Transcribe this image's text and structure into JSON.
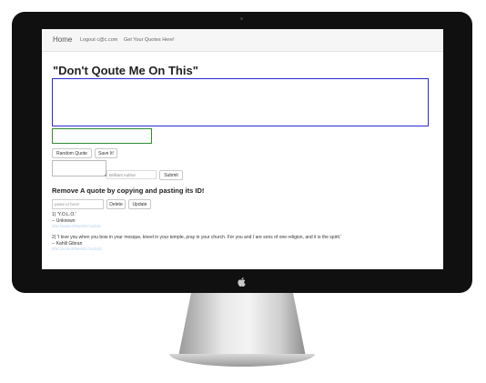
{
  "navbar": {
    "home_label": "Home",
    "logout_label": "Logout c@c.com",
    "get_quotes_label": "Get Your Quotes Here!"
  },
  "main": {
    "title": "\"Don't Qoute Me On This\"",
    "random_quote_button": "Random Quote",
    "save_button": "Save It!",
    "author_placeholder": "Brilliant Author",
    "submit_button": "Submit",
    "remove_heading": "Remove A quote by copying and pasting its ID!",
    "id_placeholder": "paste id here!",
    "delete_button": "Delete",
    "update_button": "Update"
  },
  "quotes": [
    {
      "text": "1) 'Y.O.L.O.'",
      "author": "-- Unknown",
      "id": "5f4c15a3e1f09e0017a1b2c"
    },
    {
      "text": "2) 'I love you when you bow in your mosque, kneel in your temple, pray in your church. For you and I are sons of one religion, and it is the spirit.'",
      "author": "-- Kahlil Gibran",
      "id": "5f4c15c0e1f09e0017a1b2d"
    }
  ],
  "colors": {
    "quote_textarea_border": "#2b2bd6",
    "author_input_border": "#2e8b2e",
    "monitor_frame": "#101010",
    "quote_id_text": "#b8d2ea"
  },
  "icons": {
    "apple_logo": "apple-logo-icon"
  }
}
